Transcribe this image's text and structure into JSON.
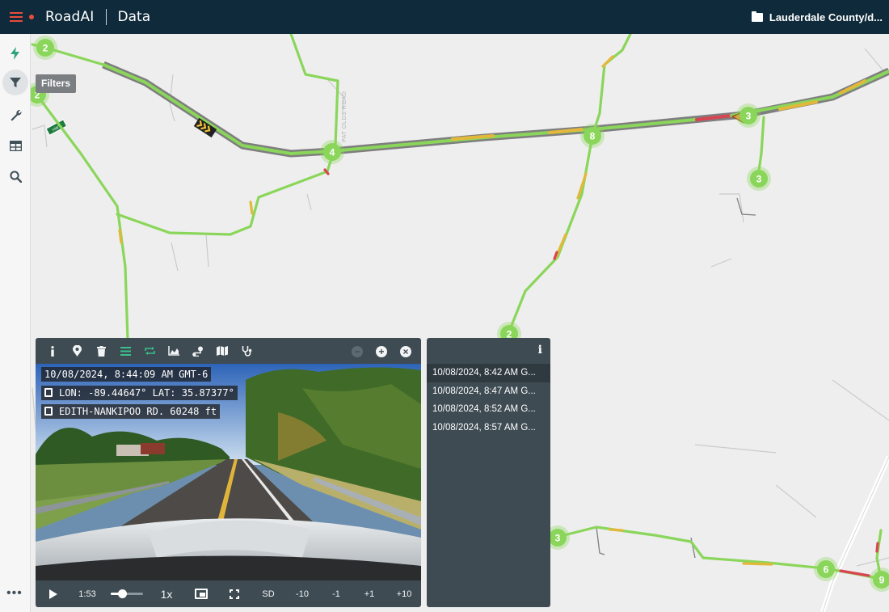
{
  "app": {
    "brand": "RoadAI",
    "section": "Data",
    "folder": "Lauderdale County/d..."
  },
  "colors": {
    "topbar": "#0f2a3a",
    "accent_red": "#e74c3c",
    "panel": "#3e4b53",
    "road_good": "#8ad65a",
    "road_fair": "#e3b83a",
    "road_poor": "#d94452",
    "cluster": "#8ad65a"
  },
  "rail": {
    "items": [
      {
        "icon": "lightning-icon"
      },
      {
        "icon": "filter-icon",
        "tooltip": "Filters"
      },
      {
        "icon": "wrench-icon"
      },
      {
        "icon": "table-icon"
      },
      {
        "icon": "search-icon"
      }
    ],
    "more": "•••"
  },
  "map": {
    "clusters": [
      "2",
      "2",
      "4",
      "8",
      "3",
      "3",
      "2",
      "3",
      "6",
      "9"
    ],
    "road_labels": [
      "PAT OLDS ROAD",
      "HWY"
    ]
  },
  "video_panel": {
    "toolbar_icons": [
      "info-icon",
      "pin-icon",
      "trash-icon",
      "list-icon",
      "repeat-icon",
      "area-chart-icon",
      "route-icon",
      "map-icon",
      "stethoscope-icon"
    ],
    "toolbar_right": {
      "minus": "−",
      "plus": "+",
      "close": "×"
    },
    "overlay": {
      "datetime": "10/08/2024, 8:44:09 AM GMT-6",
      "lon_label": "LON:",
      "lon_value": "-89.44647°",
      "lat_label": "LAT:",
      "lat_value": "35.87377°",
      "road": "EDITH-NANKIPOO RD.",
      "distance": "60248 ft"
    },
    "controls": {
      "time": "1:53",
      "volume_percent": 35,
      "speed": "1x",
      "quality": "SD",
      "skip_back_10": "-10",
      "skip_back_1": "-1",
      "skip_fwd_1": "+1",
      "skip_fwd_10": "+10"
    }
  },
  "timestamps": {
    "info": "i",
    "items": [
      "10/08/2024, 8:42 AM G...",
      "10/08/2024, 8:47 AM G...",
      "10/08/2024, 8:52 AM G...",
      "10/08/2024, 8:57 AM G..."
    ]
  }
}
